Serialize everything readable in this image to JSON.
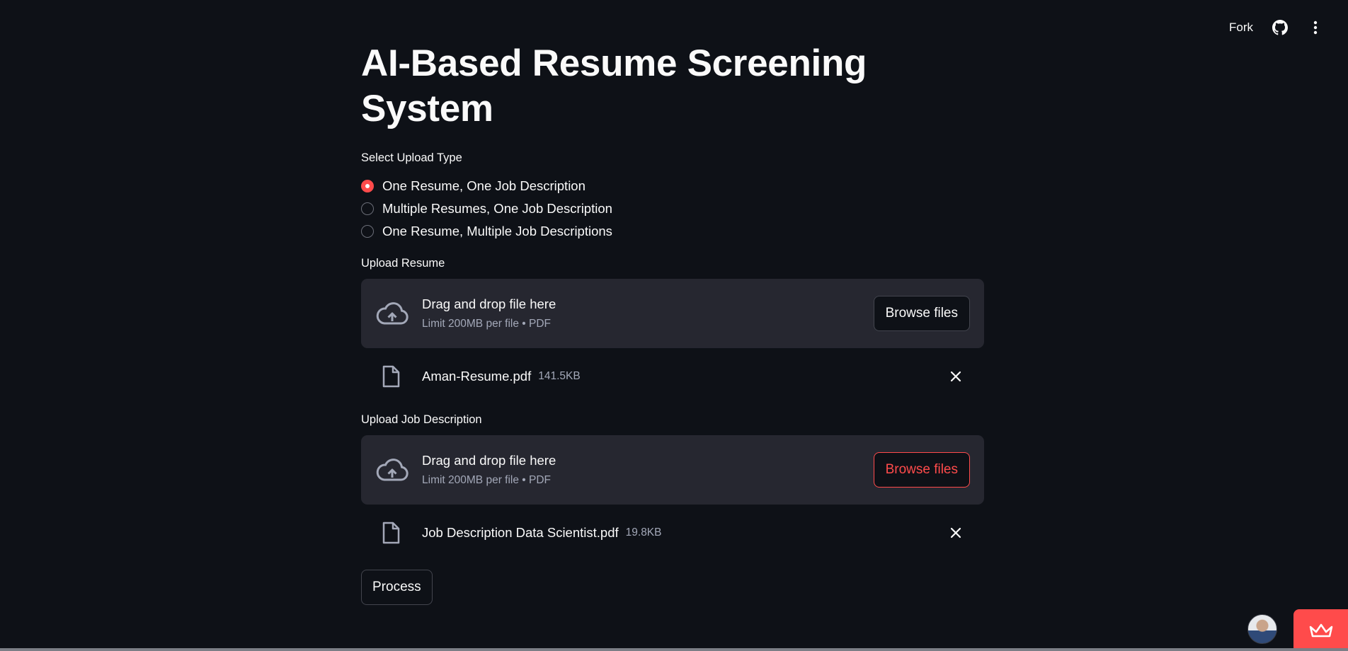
{
  "header": {
    "fork_label": "Fork",
    "github_icon": "github-icon",
    "menu_icon": "kebab-menu-icon"
  },
  "page": {
    "title": "AI-Based Resume Screening System"
  },
  "upload_type": {
    "label": "Select Upload Type",
    "options": [
      {
        "label": "One Resume, One Job Description",
        "selected": true
      },
      {
        "label": "Multiple Resumes, One Job Description",
        "selected": false
      },
      {
        "label": "One Resume, Multiple Job Descriptions",
        "selected": false
      }
    ]
  },
  "resume_upload": {
    "label": "Upload Resume",
    "drop_text": "Drag and drop file here",
    "limit_text": "Limit 200MB per file • PDF",
    "browse_label": "Browse files",
    "file": {
      "name": "Aman-Resume.pdf",
      "size": "141.5KB"
    }
  },
  "jd_upload": {
    "label": "Upload Job Description",
    "drop_text": "Drag and drop file here",
    "limit_text": "Limit 200MB per file • PDF",
    "browse_label": "Browse files",
    "file": {
      "name": "Job Description Data Scientist.pdf",
      "size": "19.8KB"
    }
  },
  "actions": {
    "process_label": "Process"
  },
  "colors": {
    "background": "#0e1117",
    "accent": "#ff4b4b",
    "dropzone": "#262730"
  }
}
